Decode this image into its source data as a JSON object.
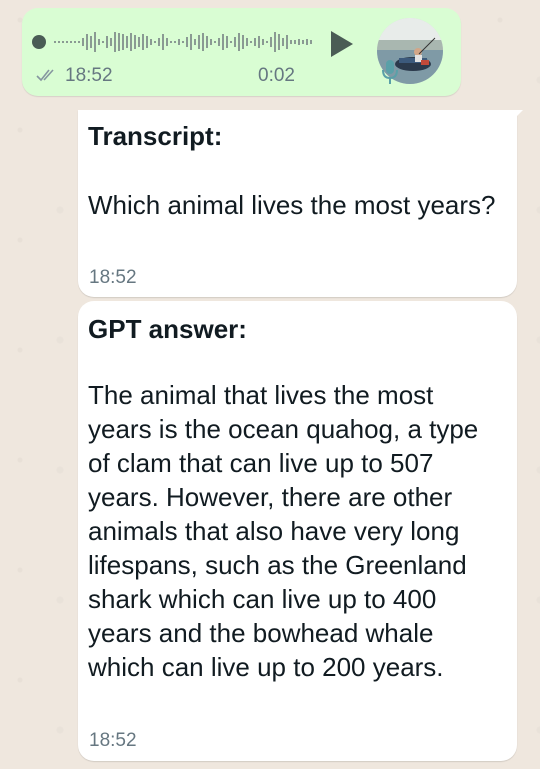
{
  "voice_message": {
    "time": "18:52",
    "duration": "0:02"
  },
  "transcript": {
    "heading": "Transcript:",
    "text": "Which animal lives the most years?",
    "time": "18:52"
  },
  "answer": {
    "heading": "GPT answer:",
    "text": "The animal that lives the most years is the ocean quahog, a type of clam that can live up to 507 years. However, there are other animals that also have very long lifespans, such as the Greenland shark which can live up to 400 years and the bowhead whale which can live up to 200 years.",
    "time": "18:52"
  },
  "colors": {
    "outgoing_bubble": "#d9fdd3",
    "incoming_bubble": "#ffffff",
    "background": "#efe7de",
    "meta_text": "#667781"
  }
}
